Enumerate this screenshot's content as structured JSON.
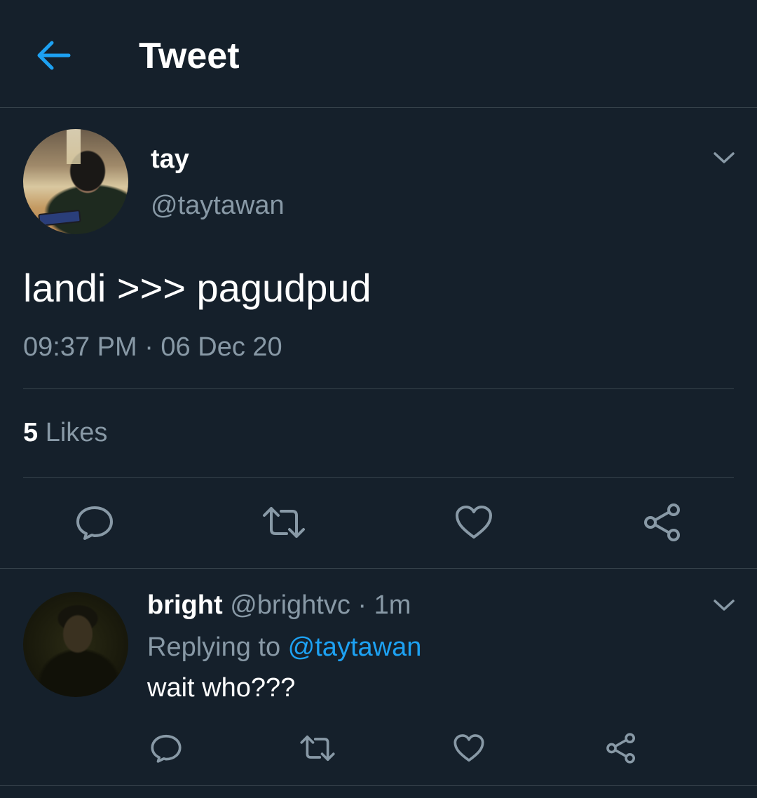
{
  "header": {
    "title": "Tweet",
    "back_icon": "arrow-left-icon",
    "accent": "#1da1f2"
  },
  "tweet": {
    "author_name": "tay",
    "author_handle": "@taytawan",
    "text": "landi >>> pagudpud",
    "timestamp": "09:37 PM · 06 Dec 20",
    "likes_count": "5",
    "likes_label": "Likes",
    "more_icon": "chevron-down-icon",
    "actions": [
      "reply-icon",
      "retweet-icon",
      "like-icon",
      "share-icon"
    ]
  },
  "reply": {
    "author_name": "bright",
    "author_handle": "@brightvc",
    "separator": " · ",
    "time_ago": "1m",
    "replying_prefix": "Replying to ",
    "replying_to": "@taytawan",
    "text": "wait who???",
    "more_icon": "chevron-down-icon",
    "actions": [
      "reply-icon",
      "retweet-icon",
      "like-icon",
      "share-icon"
    ]
  },
  "colors": {
    "background": "#15202b",
    "divider": "#38444d",
    "secondary_text": "#8899a6",
    "link": "#1da1f2"
  }
}
